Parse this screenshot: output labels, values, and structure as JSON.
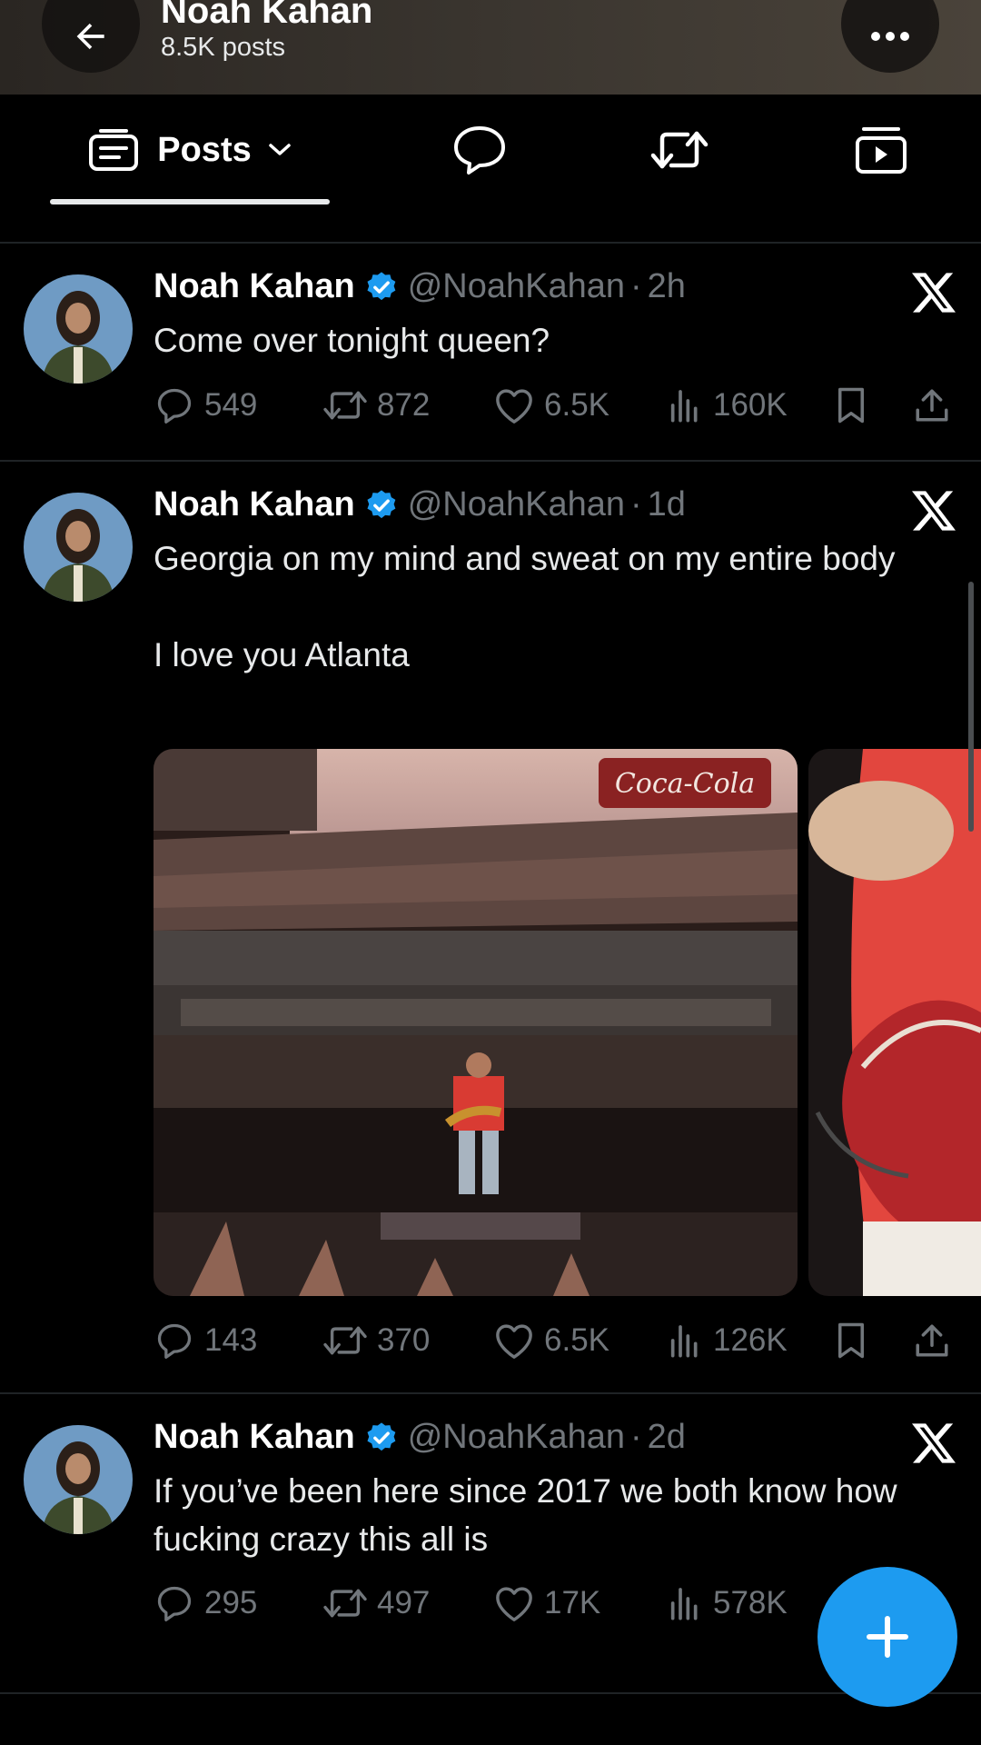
{
  "header": {
    "title": "Noah Kahan",
    "subtitle": "8.5K posts",
    "back_icon": "arrow-left-icon",
    "more_icon": "more-horizontal-icon"
  },
  "tabs": {
    "items": [
      {
        "label": "Posts",
        "icon": "posts-card-icon",
        "selected": true
      },
      {
        "label": "",
        "icon": "reply-bubble-icon"
      },
      {
        "label": "",
        "icon": "repost-icon"
      },
      {
        "label": "",
        "icon": "media-play-icon"
      }
    ]
  },
  "posts": [
    {
      "name": "Noah Kahan",
      "handle": "@NoahKahan",
      "separator": "·",
      "time": "2h",
      "text": "Come over tonight queen?",
      "replies": "549",
      "reposts": "872",
      "likes": "6.5K",
      "views": "160K"
    },
    {
      "name": "Noah Kahan",
      "handle": "@NoahKahan",
      "separator": "·",
      "time": "1d",
      "text": "Georgia on my mind and sweat on my entire body\n\nI love you Atlanta",
      "replies": "143",
      "reposts": "370",
      "likes": "6.5K",
      "views": "126K",
      "media_text": "Coca-Cola"
    },
    {
      "name": "Noah Kahan",
      "handle": "@NoahKahan",
      "separator": "·",
      "time": "2d",
      "text": "If you’ve been here since 2017 we both know how fucking crazy this all is",
      "replies": "295",
      "reposts": "497",
      "likes": "17K",
      "views": "578K"
    }
  ],
  "fab": {
    "icon": "plus-icon"
  },
  "colors": {
    "accent": "#1d9bf0",
    "background": "#000000",
    "muted": "#71767b"
  }
}
